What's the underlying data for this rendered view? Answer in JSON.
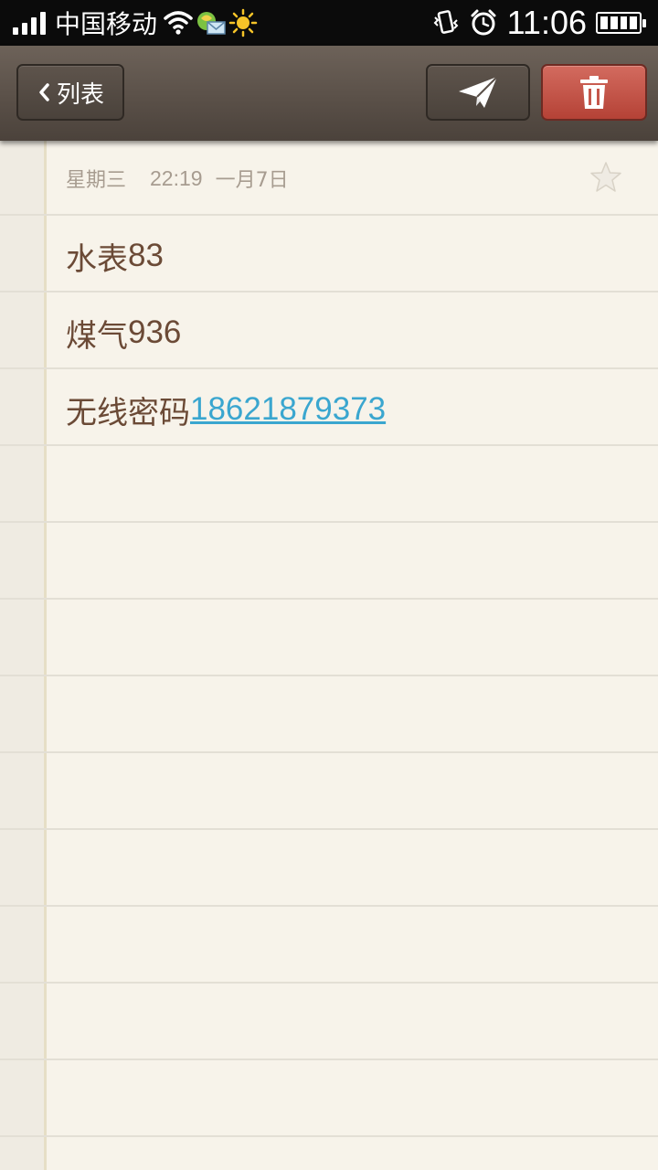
{
  "status_bar": {
    "carrier": "中国移动",
    "time": "11:06",
    "icons": [
      "signal-icon",
      "wifi-icon",
      "message-icon",
      "sun-icon",
      "vibrate-icon",
      "alarm-icon",
      "battery-icon"
    ]
  },
  "toolbar": {
    "back_label": "列表",
    "icons": [
      "chevron-left-icon",
      "send-icon",
      "trash-icon"
    ]
  },
  "note": {
    "day": "星期三",
    "time": "22:19",
    "date": "一月7日",
    "lines": [
      {
        "text": "水表",
        "number": "83"
      },
      {
        "text": "煤气",
        "number": "936"
      },
      {
        "text": "无线密码",
        "link": "18621879373"
      }
    ]
  },
  "colors": {
    "toolbar": "#5a5048",
    "delete_button": "#c5564a",
    "paper": "#f7f3ea",
    "note_text": "#6b4a36",
    "link": "#3aa6cf"
  }
}
